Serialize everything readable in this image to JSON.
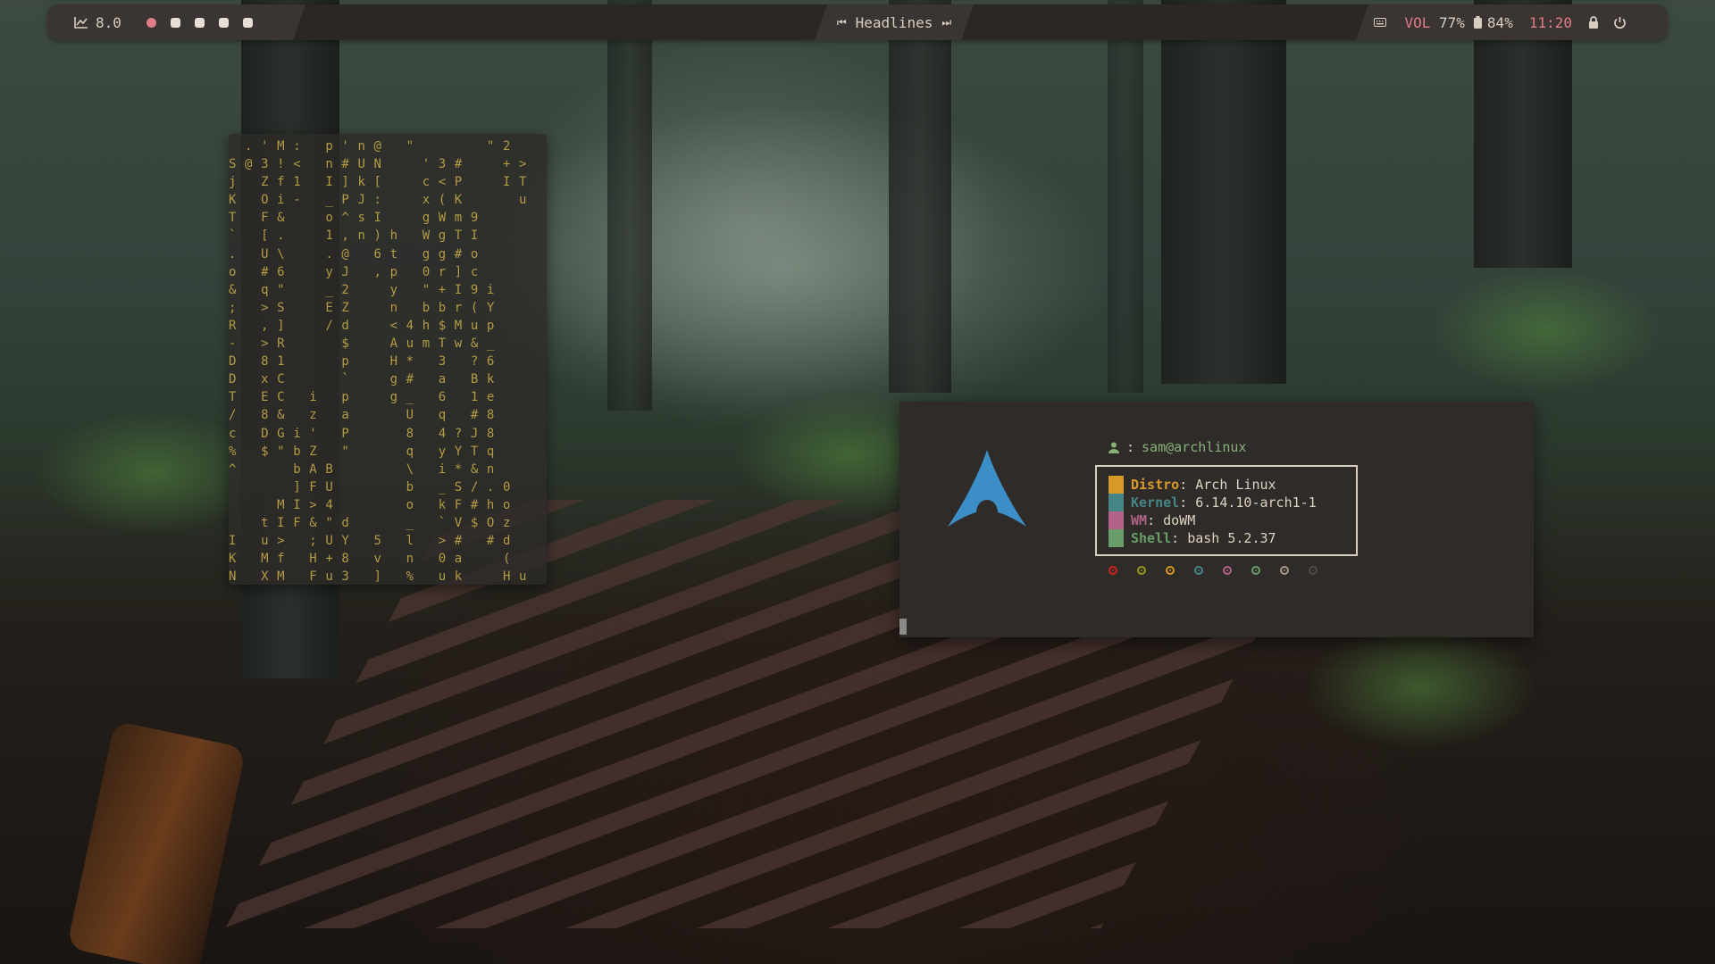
{
  "topbar": {
    "cpu_icon": "chart-line-icon",
    "cpu_value": "8.0",
    "workspaces": [
      {
        "active": true
      },
      {
        "active": false
      },
      {
        "active": false
      },
      {
        "active": false
      },
      {
        "active": false
      }
    ],
    "media": {
      "prev_icon": "skip-back-icon",
      "title": "Headlines",
      "next_icon": "skip-forward-icon"
    },
    "keyboard_icon": "keyboard-icon",
    "volume_label": "VOL",
    "volume_value": "77%",
    "battery_icon": "battery-icon",
    "battery_value": "84%",
    "clock": "11:20",
    "lock_icon": "lock-icon",
    "power_icon": "power-icon"
  },
  "matrix_terminal": {
    "lines": [
      "  . ' M :   p ' n @   \"         \" 2",
      "S @ 3 ! <   n # U N     ' 3 #     + >",
      "j   Z f 1   I ] k [     c < P     I T",
      "K   O i -   _ P J :     x ( K       u",
      "T   F &     o ^ s I     g W m 9",
      "`   [ .     1 , n ) h   W g T I",
      ".   U \\     . @   6 t   g g # o",
      "o   # 6     y J   , p   0 r ] c",
      "&   q \"     _ 2     y   \" + I 9 i",
      ";   > S     E Z     n   b b r ( Y",
      "R   , ]     / d     < 4 h $ M u p",
      "-   > R       $     A u m T w & _",
      "D   8 1       p     H *   3   ? 6",
      "D   x C       `     g #   a   B k",
      "T   E C   i   p     g _   6   1 e",
      "/   8 &   z   a       U   q   # 8",
      "c   D G i '   P       8   4 ? J 8",
      "%   $ \" b Z   \"       q   y Y T q",
      "^       b A B         \\   i * & n",
      "        ] F U         b   _ S / . 0",
      "      M I > 4         o   k F # h o",
      "    t I F & \" d       _   ` V $ O z",
      "I   u >   ; U Y   5   l   > #   # d",
      "K   M f   H + 8   v   n   0 a     (",
      "N   X M   F u 3   ]   %   u k     H u"
    ]
  },
  "fetch_terminal": {
    "logo_icon": "arch-linux-logo-icon",
    "user_icon": "user-icon",
    "user_sep": ":",
    "user_host": "sam@archlinux",
    "rows": [
      {
        "key": "Distro",
        "value": "Arch Linux",
        "color": "#d79a28"
      },
      {
        "key": "Kernel",
        "value": "6.14.10-arch1-1",
        "color": "#458588"
      },
      {
        "key": "WM",
        "value": "doWM",
        "color": "#b16286"
      },
      {
        "key": "Shell",
        "value": "bash 5.2.37",
        "color": "#689d6a"
      }
    ],
    "palette": [
      "#cc241d",
      "#98971a",
      "#d79921",
      "#458588",
      "#b16286",
      "#689d6a",
      "#a89984",
      "#504945"
    ]
  },
  "colors": {
    "accent": "#e07d87",
    "matrix_text": "#b39b44",
    "arch_blue": "#3b8fc6"
  }
}
